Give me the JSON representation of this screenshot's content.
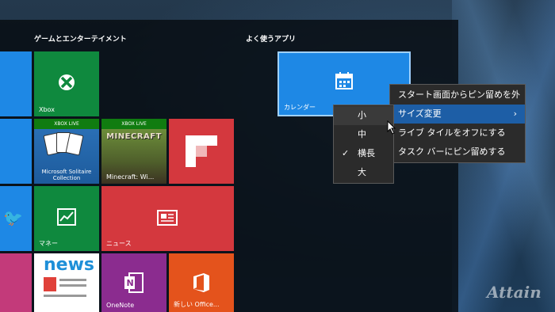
{
  "groups": {
    "games_title": "ゲームとエンターテイメント",
    "frequent_title": "よく使うアプリ"
  },
  "tiles": {
    "xbox": "Xbox",
    "xbox_live_1": "XBOX LIVE",
    "xbox_live_2": "XBOX LIVE",
    "solitaire": "Microsoft Solitaire Collection",
    "minecraft_art": "MINECRAFT",
    "minecraft": "Minecraft: Wi...",
    "money": "マネー",
    "news": "ニュース",
    "news_art": "news",
    "onenote": "OneNote",
    "office": "新しい Office...",
    "calendar": "カレンダー"
  },
  "context_menu": {
    "unpin": "スタート画面からピン留めを外す",
    "resize": "サイズ変更",
    "live_tile_off": "ライブ タイルをオフにする",
    "pin_taskbar": "タスク バーにピン留めする"
  },
  "size_menu": {
    "small": "小",
    "medium": "中",
    "wide": "横長",
    "large": "大",
    "selected": "横長"
  },
  "watermark": "Attain",
  "icons": {
    "xbox": "xbox-icon",
    "calendar": "calendar-icon",
    "money": "chart-icon",
    "news": "news-icon",
    "onenote": "onenote-icon",
    "office": "office-icon",
    "flipboard": "flipboard-icon",
    "twitter": "twitter-icon"
  },
  "colors": {
    "accent": "#1e88e5",
    "menu_highlight": "#1d5ea6",
    "xbox_green": "#107c10"
  }
}
